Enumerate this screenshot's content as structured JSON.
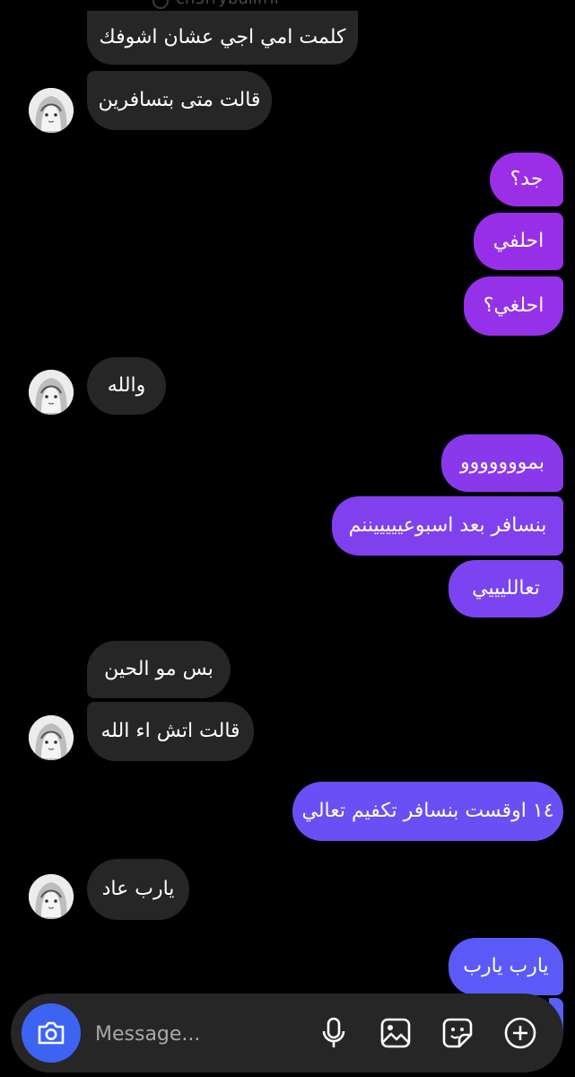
{
  "header": {
    "partial_text": "ch3rrybullfrif"
  },
  "messages": [
    {
      "side": "in",
      "text": "كلمت امي اجي عشان اشوفك"
    },
    {
      "side": "in",
      "text": "قالت متى بتسافرين",
      "avatar": true
    },
    {
      "side": "out",
      "text": "جد؟"
    },
    {
      "side": "out",
      "text": "احلفي"
    },
    {
      "side": "out",
      "text": "احلغي؟"
    },
    {
      "side": "in",
      "text": "والله",
      "avatar": true
    },
    {
      "side": "out",
      "text": "بمووووووو"
    },
    {
      "side": "out",
      "text": "بنسافر بعد اسبوعيييييننم"
    },
    {
      "side": "out",
      "text": "تعالليييي"
    },
    {
      "side": "in",
      "text": "بس مو الحين"
    },
    {
      "side": "in",
      "text": "قالت اتش اء الله",
      "avatar": true
    },
    {
      "side": "out",
      "text": "١٤ اوقست بنسافر تكفيم تعالي"
    },
    {
      "side": "in",
      "text": "يارب عاد",
      "avatar": true
    },
    {
      "side": "out",
      "text": "يارب يارب"
    }
  ],
  "composer": {
    "placeholder": "Message...",
    "icons": [
      "camera-icon",
      "microphone-icon",
      "gallery-icon",
      "sticker-icon",
      "add-icon"
    ]
  },
  "colors": {
    "background": "#000000",
    "incoming_bubble": "#262626",
    "outgoing_gradient": [
      "#9a2ee8",
      "#6b4cf5",
      "#5b5cf8"
    ],
    "camera_button": "#3d63f2"
  }
}
